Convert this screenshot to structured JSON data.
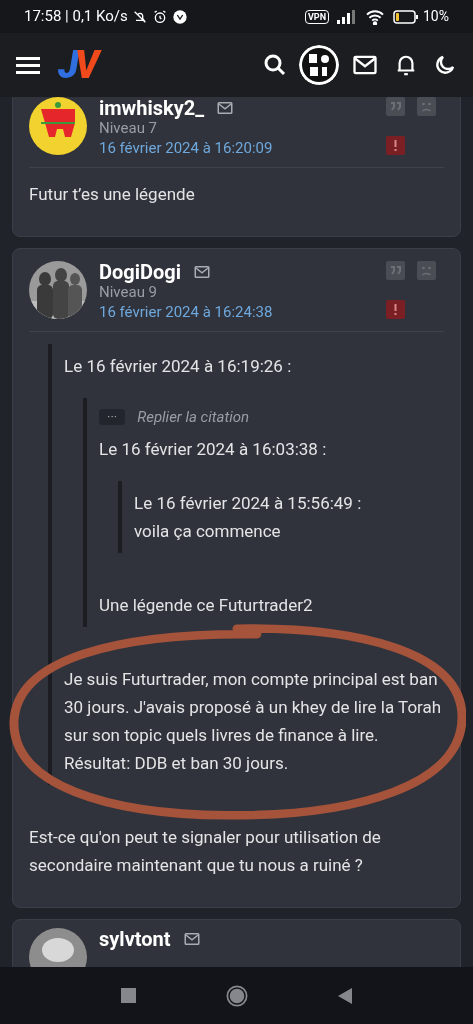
{
  "status_bar": {
    "time": "17:58 | 0,1 Ko/s",
    "vpn": "VPN",
    "battery": "10%"
  },
  "header": {
    "logo": "JV"
  },
  "posts": [
    {
      "author": "imwhisky2_",
      "rank": "Niveau 7",
      "date": "16 février 2024 à 16:20:09",
      "body": [
        {
          "kind": "text",
          "text": "Futur t’es une légende"
        }
      ]
    },
    {
      "author": "DogiDogi",
      "rank": "Niveau 9",
      "date": "16 février 2024 à 16:24:38",
      "body": [
        {
          "kind": "quote",
          "children": [
            {
              "kind": "text",
              "text": "Le 16 février 2024 à 16:19:26 :"
            },
            {
              "kind": "quote",
              "children": [
                {
                  "kind": "toggle",
                  "icon": "···",
                  "label": "Replier la citation"
                },
                {
                  "kind": "text",
                  "text": "Le 16 février 2024 à 16:03:38 :"
                },
                {
                  "kind": "quote",
                  "children": [
                    {
                      "kind": "text",
                      "text": "Le 16 février 2024 à 15:56:49 :\nvoila ça commence"
                    }
                  ]
                },
                {
                  "kind": "text",
                  "text": "Une légende ce Futurtrader2"
                }
              ]
            },
            {
              "kind": "circled",
              "children": [
                {
                  "kind": "text",
                  "text": "Je suis Futurtrader, mon compte principal est ban 30 jours. J'avais proposé à un khey de lire la Torah sur son topic quels livres de finance à lire. Résultat: DDB et ban 30 jours."
                }
              ]
            }
          ]
        },
        {
          "kind": "text",
          "text": "Est-ce qu'on peut te signaler pour utilisation de secondaire maintenant que tu nous a ruiné ?"
        }
      ]
    },
    {
      "author": "sylvtont"
    }
  ]
}
